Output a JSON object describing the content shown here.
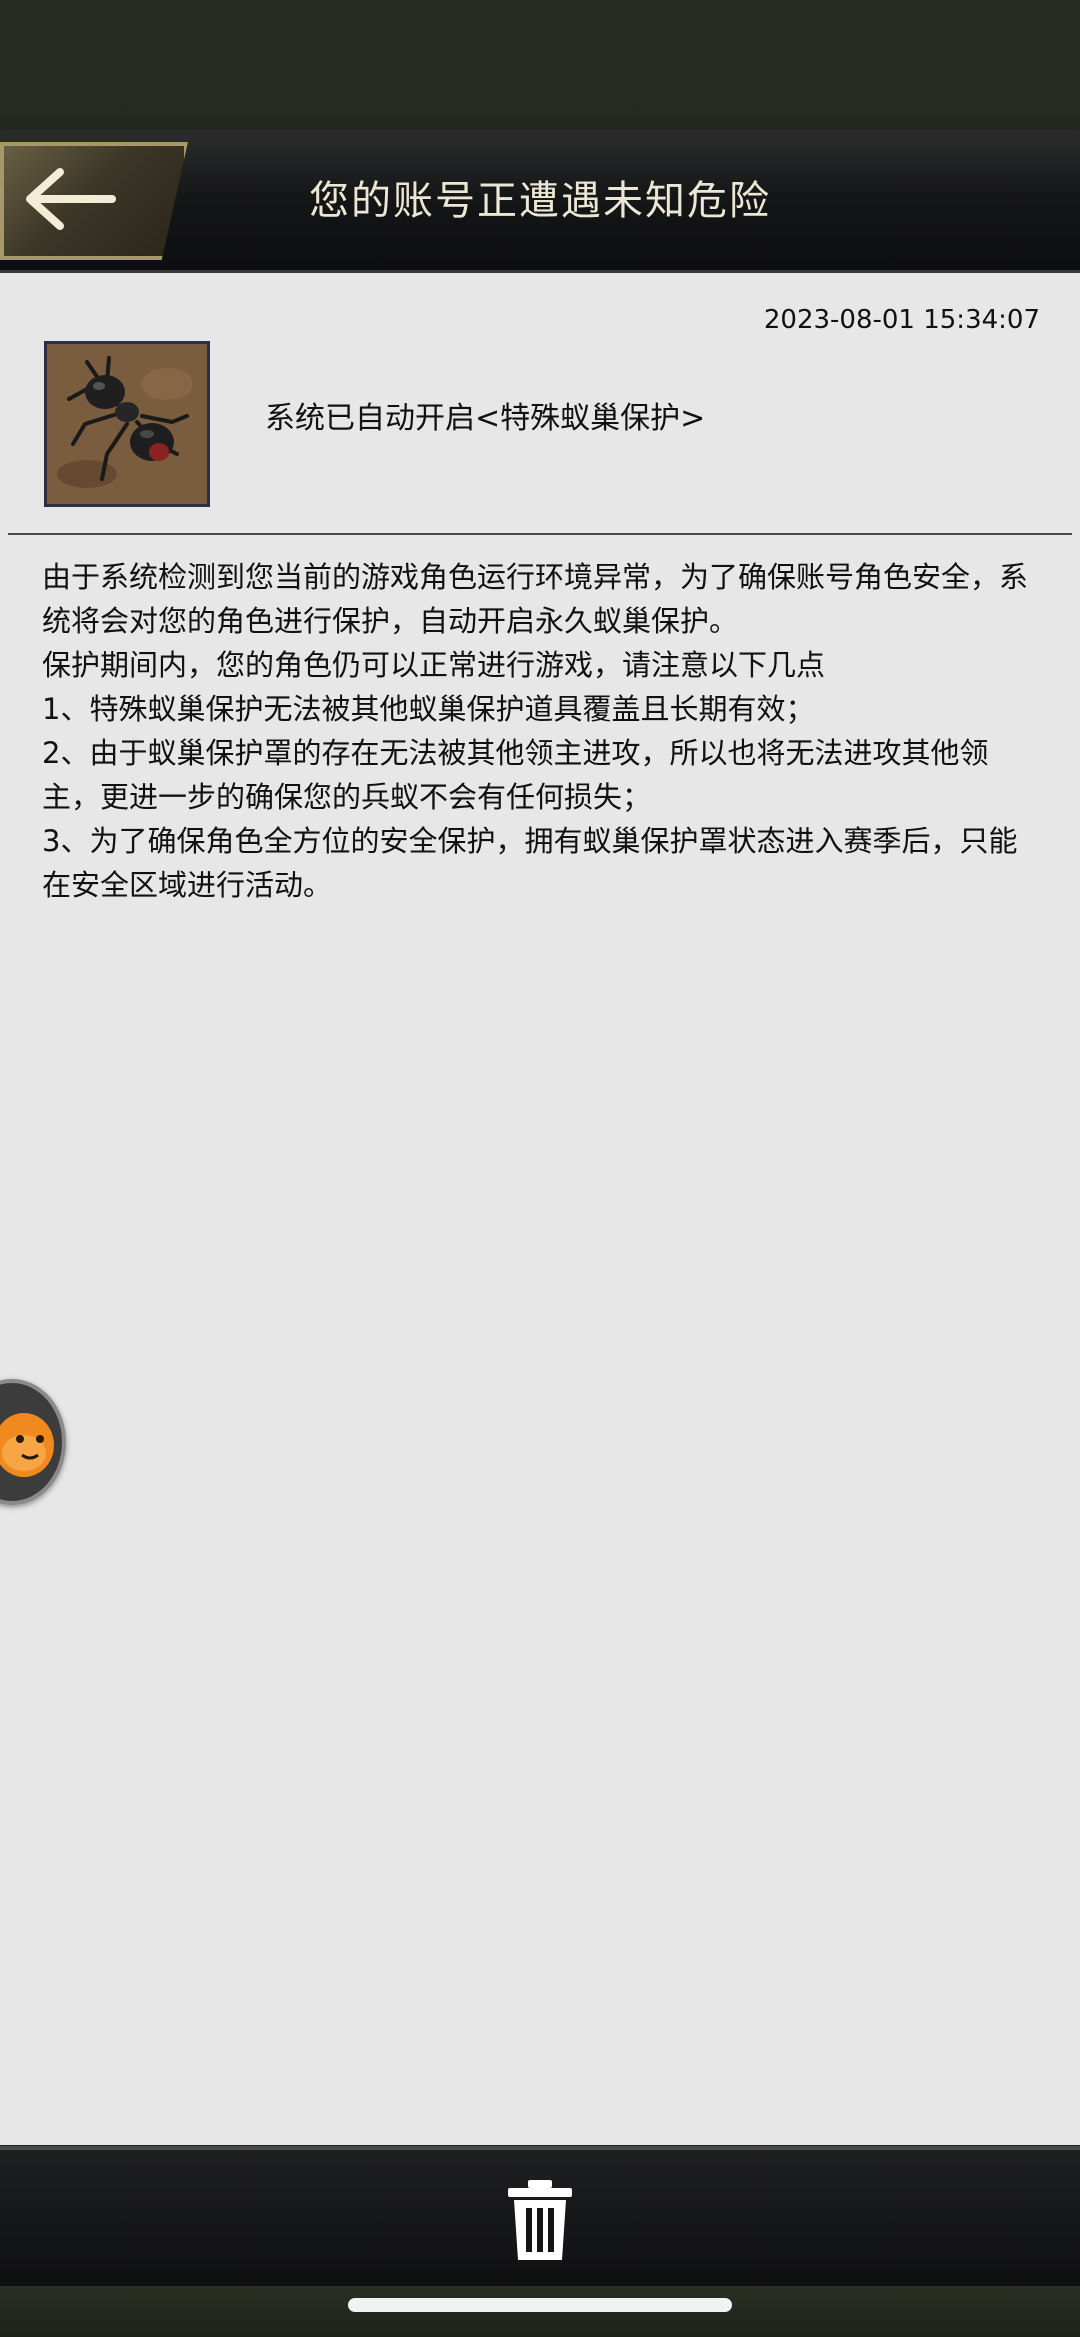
{
  "header": {
    "title": "您的账号正遭遇未知危险",
    "back_icon": "arrow-left-icon"
  },
  "mail": {
    "timestamp": "2023-08-01 15:34:07",
    "subject": "系统已自动开启<特殊蚁巢保护>",
    "avatar_icon": "ant-avatar",
    "body_lines": [
      "由于系统检测到您当前的游戏角色运行环境异常，为了确保账号角色安全，系统将会对您的角色进行保护，自动开启永久蚁巢保护。",
      "保护期间内，您的角色仍可以正常进行游戏，请注意以下几点",
      "1、特殊蚁巢保护无法被其他蚁巢保护道具覆盖且长期有效；",
      "2、由于蚁巢保护罩的存在无法被其他领主进攻，所以也将无法进攻其他领主，更进一步的确保您的兵蚁不会有任何损失；",
      "3、为了确保角色全方位的安全保护，拥有蚁巢保护罩状态进入赛季后，只能在安全区域进行活动。"
    ]
  },
  "footer": {
    "delete_icon": "trash-icon"
  },
  "floating": {
    "icon": "assistant-mascot-icon"
  },
  "colors": {
    "header_text": "#ece6d4",
    "panel_bg": "#e7e7e7",
    "back_button_gold": "#a8976a"
  }
}
